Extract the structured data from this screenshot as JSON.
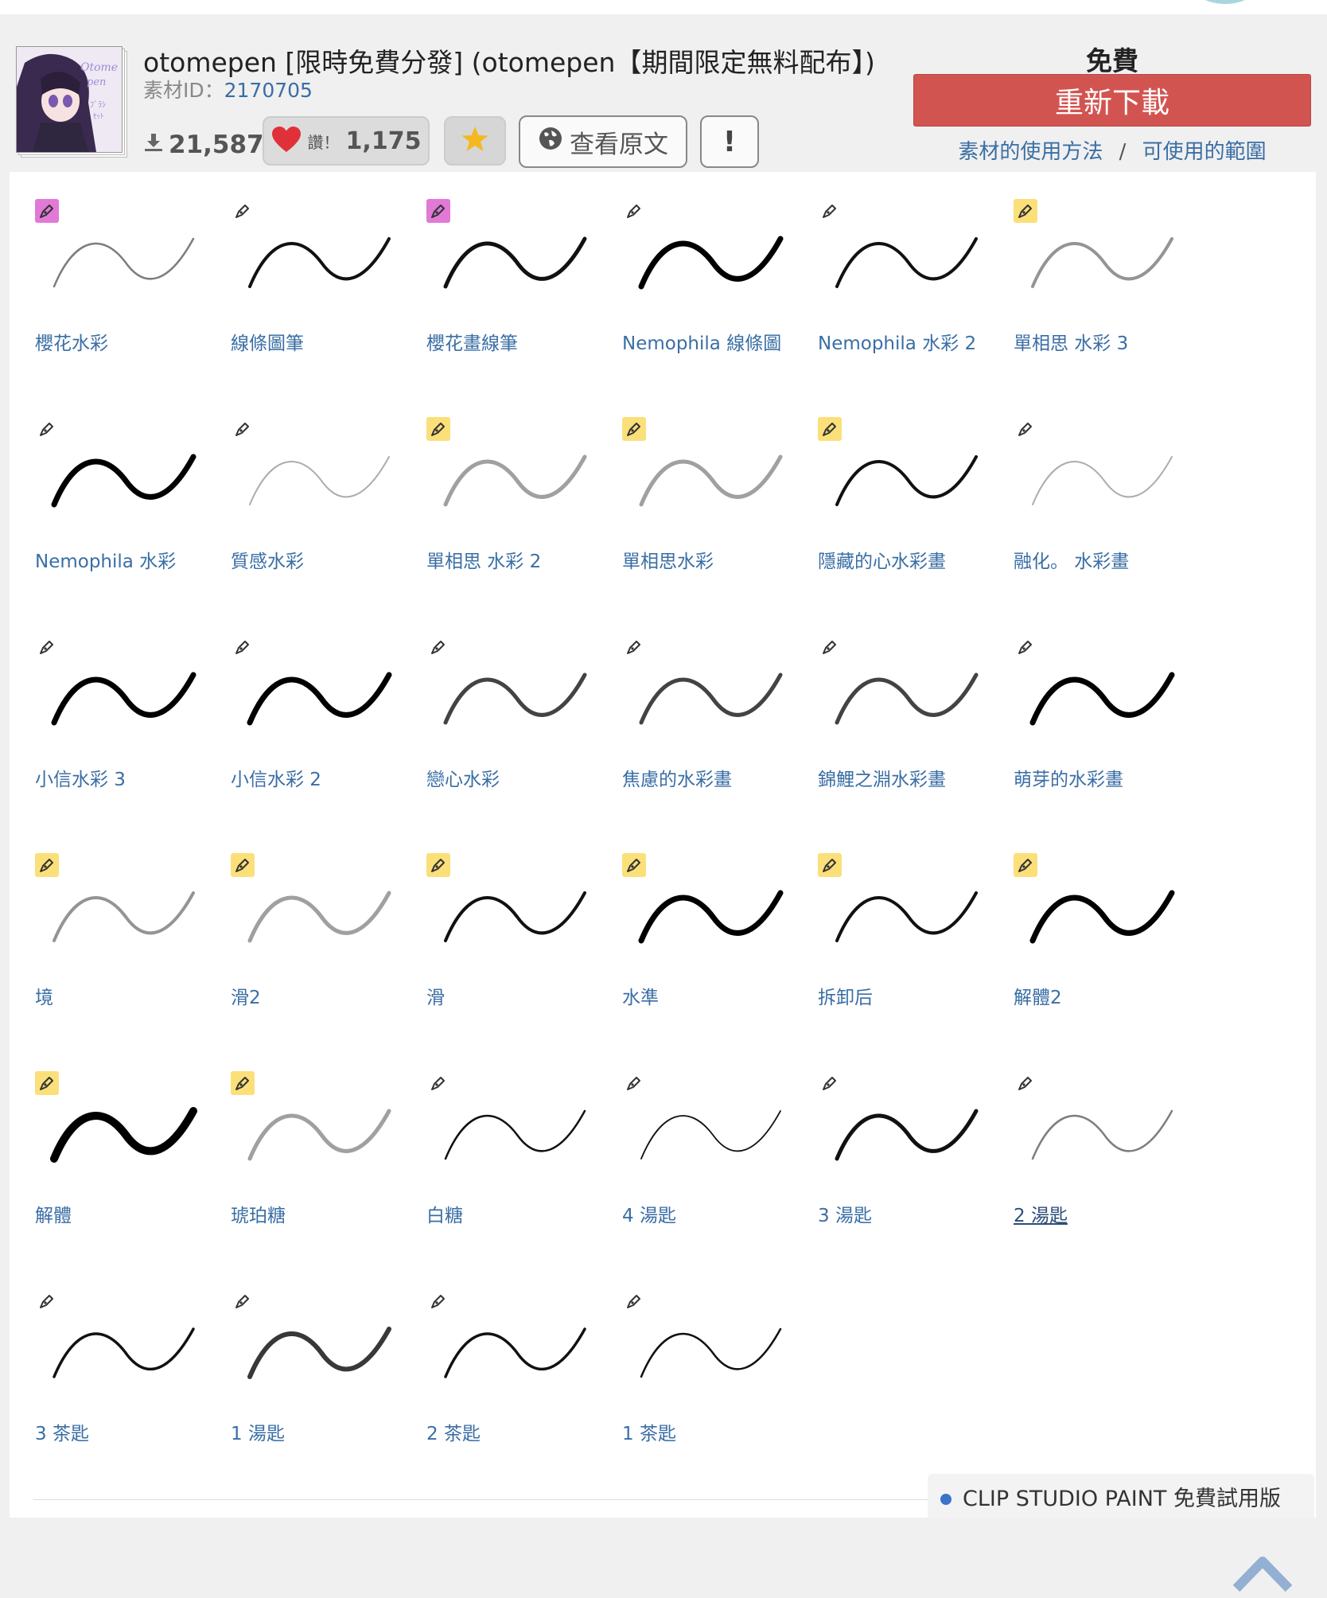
{
  "header": {
    "title": "otomepen [限時免費分發] (otomepen【期間限定無料配布】)",
    "material_id_label": "素材ID：",
    "material_id": "2170705",
    "downloads": "21,587",
    "like_label": "讚！",
    "like_count": "1,175",
    "view_original_label": "查看原文",
    "report_label": "!",
    "price": "免費",
    "download_button": "重新下載",
    "usage_link": "素材的使用方法",
    "link_separator": "/",
    "scope_link": "可使用的範圍",
    "colors": {
      "download": "#d25450",
      "link": "#3a6ea5",
      "heart": "#e0313a",
      "star": "#f5b81f"
    }
  },
  "brushes": [
    {
      "label": "櫻花水彩",
      "icon": "pencil-icon",
      "badge": "pink",
      "stroke": "thin-gray"
    },
    {
      "label": "線條圖筆",
      "icon": "pencil-icon",
      "badge": "none",
      "stroke": "medium-black"
    },
    {
      "label": "櫻花畫線筆",
      "icon": "pencil-icon",
      "badge": "pink",
      "stroke": "rough-black"
    },
    {
      "label": "Nemophila 線條圖",
      "icon": "pencil-icon",
      "badge": "none",
      "stroke": "thick-black"
    },
    {
      "label": "Nemophila 水彩 2",
      "icon": "pencil-icon",
      "badge": "none",
      "stroke": "medium-black"
    },
    {
      "label": "單相思 水彩 3",
      "icon": "pencil-icon",
      "badge": "yellow",
      "stroke": "gray-wide"
    },
    {
      "label": "Nemophila 水彩",
      "icon": "pencil-icon",
      "badge": "none",
      "stroke": "thick-taper"
    },
    {
      "label": "質感水彩",
      "icon": "pencil-icon",
      "badge": "none",
      "stroke": "faint-taper"
    },
    {
      "label": "單相思 水彩 2",
      "icon": "pencil-icon",
      "badge": "yellow",
      "stroke": "soft-gray"
    },
    {
      "label": "單相思水彩",
      "icon": "pencil-icon",
      "badge": "yellow",
      "stroke": "soft-gray"
    },
    {
      "label": "隱藏的心水彩畫",
      "icon": "pencil-icon",
      "badge": "yellow",
      "stroke": "medium-black"
    },
    {
      "label": "融化。 水彩畫",
      "icon": "pencil-icon",
      "badge": "none",
      "stroke": "faint-taper"
    },
    {
      "label": "小信水彩 3",
      "icon": "pencil-icon",
      "badge": "none",
      "stroke": "thick-taper"
    },
    {
      "label": "小信水彩 2",
      "icon": "pencil-icon",
      "badge": "none",
      "stroke": "thick-taper"
    },
    {
      "label": "戀心水彩",
      "icon": "pencil-icon",
      "badge": "none",
      "stroke": "soft-black"
    },
    {
      "label": "焦慮的水彩畫",
      "icon": "pencil-icon",
      "badge": "none",
      "stroke": "soft-black"
    },
    {
      "label": "錦鯉之淵水彩畫",
      "icon": "pencil-icon",
      "badge": "none",
      "stroke": "soft-black"
    },
    {
      "label": "萌芽的水彩畫",
      "icon": "pencil-icon",
      "badge": "none",
      "stroke": "thick-taper"
    },
    {
      "label": "境",
      "icon": "pencil-icon",
      "badge": "yellow",
      "stroke": "gray-wide"
    },
    {
      "label": "滑2",
      "icon": "pencil-icon",
      "badge": "yellow",
      "stroke": "soft-gray"
    },
    {
      "label": "滑",
      "icon": "pencil-icon",
      "badge": "yellow",
      "stroke": "medium-black"
    },
    {
      "label": "水準",
      "icon": "pencil-icon",
      "badge": "yellow",
      "stroke": "thick-black"
    },
    {
      "label": "拆卸后",
      "icon": "pencil-icon",
      "badge": "yellow",
      "stroke": "medium-black"
    },
    {
      "label": "解體2",
      "icon": "pencil-icon",
      "badge": "yellow",
      "stroke": "thick-black"
    },
    {
      "label": "解體",
      "icon": "pencil-icon",
      "badge": "yellow",
      "stroke": "heavy-black"
    },
    {
      "label": "琥珀糖",
      "icon": "pencil-icon",
      "badge": "yellow",
      "stroke": "soft-gray"
    },
    {
      "label": "白糖",
      "icon": "pencil-icon",
      "badge": "none",
      "stroke": "rough-thin"
    },
    {
      "label": "4 湯匙",
      "icon": "pencil-icon",
      "badge": "none",
      "stroke": "hair-black"
    },
    {
      "label": "3 湯匙",
      "icon": "pencil-icon",
      "badge": "none",
      "stroke": "rough-black"
    },
    {
      "label": "2 湯匙",
      "icon": "pencil-icon",
      "badge": "none",
      "stroke": "thin-gray",
      "hover": true
    },
    {
      "label": "3 茶匙",
      "icon": "pencil-icon",
      "badge": "none",
      "stroke": "grainy"
    },
    {
      "label": "1 湯匙",
      "icon": "pencil-icon",
      "badge": "none",
      "stroke": "grainy-heavy"
    },
    {
      "label": "2 茶匙",
      "icon": "pencil-icon",
      "badge": "none",
      "stroke": "grainy"
    },
    {
      "label": "1 茶匙",
      "icon": "pencil-icon",
      "badge": "none",
      "stroke": "rough-thin"
    }
  ],
  "scroll_top_icon": "chevron-up-icon",
  "promo": {
    "text": "CLIP STUDIO PAINT 免費試用版"
  }
}
